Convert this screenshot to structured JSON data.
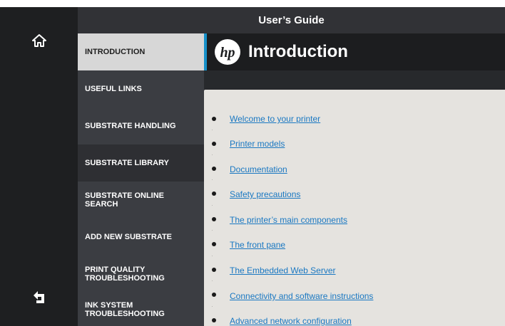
{
  "window": {
    "title": "User’s Guide"
  },
  "rail": {
    "home_icon": "home-icon",
    "back_icon": "back-arrow-icon"
  },
  "sidebar": {
    "items": [
      {
        "label": "INTRODUCTION",
        "active": true
      },
      {
        "label": "USEFUL LINKS"
      },
      {
        "label": "SUBSTRATE HANDLING"
      },
      {
        "label": "SUBSTRATE LIBRARY"
      },
      {
        "label": "SUBSTRATE ONLINE SEARCH"
      },
      {
        "label": "ADD NEW SUBSTRATE"
      },
      {
        "label": "PRINT QUALITY TROUBLESHOOTING"
      },
      {
        "label": "INK SYSTEM TROUBLESHOOTING"
      }
    ]
  },
  "header": {
    "logo": "hp",
    "title": "Introduction",
    "accent_color": "#1690c8"
  },
  "links": [
    "Welcome to your printer",
    "Printer models ",
    "Documentation",
    "Safety precautions",
    "The printer’s main components",
    "The front pane",
    "The Embedded Web Server",
    "Connectivity and software instructions",
    "Advanced network configuration"
  ]
}
